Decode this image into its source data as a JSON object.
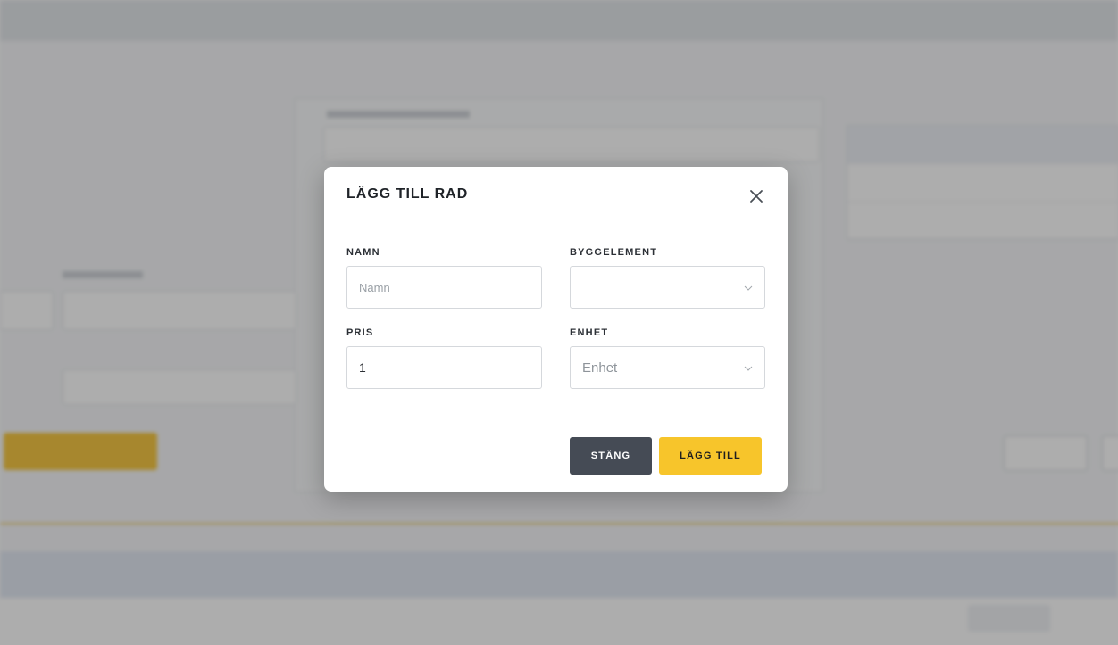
{
  "modal": {
    "title": "LÄGG TILL RAD",
    "fields": {
      "namn": {
        "label": "NAMN",
        "placeholder": "Namn",
        "value": ""
      },
      "byggelement": {
        "label": "BYGGELEMENT",
        "value": ""
      },
      "pris": {
        "label": "PRIS",
        "value": "1"
      },
      "enhet": {
        "label": "ENHET",
        "value": "Enhet"
      }
    },
    "buttons": {
      "close_label": "STÄNG",
      "add_label": "LÄGG TILL"
    }
  },
  "icons": {
    "close": "close-icon",
    "dropdown": "chevron-down-icon"
  },
  "colors": {
    "primary_yellow": "#f7c52b",
    "dark_button": "#454b55",
    "overlay": "rgba(0,0,0,0.32)"
  }
}
